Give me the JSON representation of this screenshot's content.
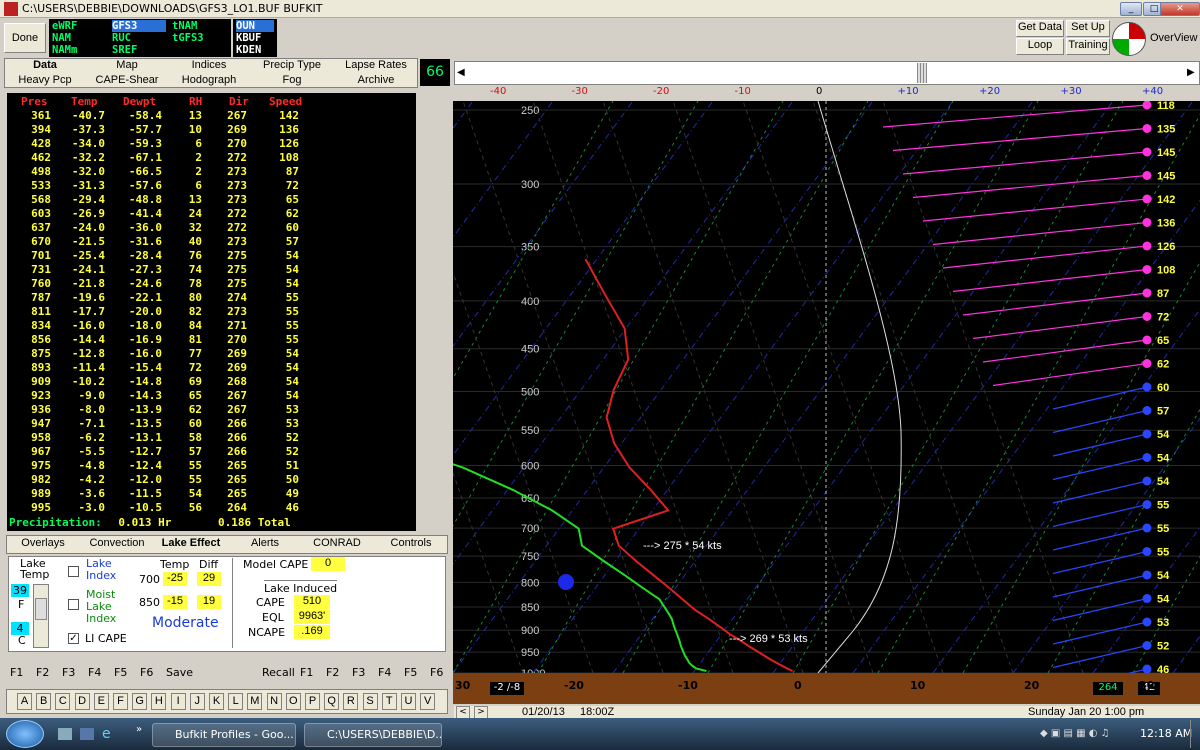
{
  "window": {
    "title": "C:\\USERS\\DEBBIE\\DOWNLOADS\\GFS3_LO1.BUF BUFKIT"
  },
  "toolbar": {
    "done": "Done",
    "models_col1": [
      "eWRF",
      "NAM",
      "NAMm"
    ],
    "models_col2": [
      "GFS3",
      "RUC",
      "SREF"
    ],
    "models_col3": [
      "tNAM",
      "tGFS3",
      ""
    ],
    "stations": [
      "OUN",
      "KBUF",
      "KDEN"
    ],
    "get_data": "Get Data",
    "set_up": "Set Up",
    "loop": "Loop",
    "training": "Training",
    "overview": "OverView",
    "counter": "66"
  },
  "tabs_row1": [
    "Data",
    "Map",
    "Indices",
    "Precip Type",
    "Lapse Rates"
  ],
  "tabs_row2": [
    "Heavy Pcp",
    "CAPE-Shear",
    "Hodograph",
    "Fog",
    "Archive"
  ],
  "table": {
    "headers": [
      "Pres",
      "Temp",
      "Dewpt",
      "RH",
      "Dir",
      "Speed"
    ],
    "rows": [
      [
        "361",
        "-40.7",
        "-58.4",
        "13",
        "267",
        "142"
      ],
      [
        "394",
        "-37.3",
        "-57.7",
        "10",
        "269",
        "136"
      ],
      [
        "428",
        "-34.0",
        "-59.3",
        "6",
        "270",
        "126"
      ],
      [
        "462",
        "-32.2",
        "-67.1",
        "2",
        "272",
        "108"
      ],
      [
        "498",
        "-32.0",
        "-66.5",
        "2",
        "273",
        "87"
      ],
      [
        "533",
        "-31.3",
        "-57.6",
        "6",
        "273",
        "72"
      ],
      [
        "568",
        "-29.4",
        "-48.8",
        "13",
        "273",
        "65"
      ],
      [
        "603",
        "-26.9",
        "-41.4",
        "24",
        "272",
        "62"
      ],
      [
        "637",
        "-24.0",
        "-36.0",
        "32",
        "272",
        "60"
      ],
      [
        "670",
        "-21.5",
        "-31.6",
        "40",
        "273",
        "57"
      ],
      [
        "701",
        "-25.4",
        "-28.4",
        "76",
        "275",
        "54"
      ],
      [
        "731",
        "-24.1",
        "-27.3",
        "74",
        "275",
        "54"
      ],
      [
        "760",
        "-21.8",
        "-24.6",
        "78",
        "275",
        "54"
      ],
      [
        "787",
        "-19.6",
        "-22.1",
        "80",
        "274",
        "55"
      ],
      [
        "811",
        "-17.7",
        "-20.0",
        "82",
        "273",
        "55"
      ],
      [
        "834",
        "-16.0",
        "-18.0",
        "84",
        "271",
        "55"
      ],
      [
        "856",
        "-14.4",
        "-16.9",
        "81",
        "270",
        "55"
      ],
      [
        "875",
        "-12.8",
        "-16.0",
        "77",
        "269",
        "54"
      ],
      [
        "893",
        "-11.4",
        "-15.4",
        "72",
        "269",
        "54"
      ],
      [
        "909",
        "-10.2",
        "-14.8",
        "69",
        "268",
        "54"
      ],
      [
        "923",
        "-9.0",
        "-14.3",
        "65",
        "267",
        "54"
      ],
      [
        "936",
        "-8.0",
        "-13.9",
        "62",
        "267",
        "53"
      ],
      [
        "947",
        "-7.1",
        "-13.5",
        "60",
        "266",
        "53"
      ],
      [
        "958",
        "-6.2",
        "-13.1",
        "58",
        "266",
        "52"
      ],
      [
        "967",
        "-5.5",
        "-12.7",
        "57",
        "266",
        "52"
      ],
      [
        "975",
        "-4.8",
        "-12.4",
        "55",
        "265",
        "51"
      ],
      [
        "982",
        "-4.2",
        "-12.0",
        "55",
        "265",
        "50"
      ],
      [
        "989",
        "-3.6",
        "-11.5",
        "54",
        "265",
        "49"
      ],
      [
        "995",
        "-3.0",
        "-10.5",
        "56",
        "264",
        "46"
      ]
    ],
    "precip_label": "Precipitation:",
    "precip_hr": "0.013 Hr",
    "precip_total": "0.186 Total"
  },
  "bottom_tabs": [
    "Overlays",
    "Convection",
    "Lake Effect",
    "Alerts",
    "CONRAD",
    "Controls"
  ],
  "lake": {
    "lake_temp_label": "Lake Temp",
    "temp_f": "39",
    "unit_f": "F",
    "temp_c": "4",
    "unit_c": "C",
    "lake_index": "Lake Index",
    "moist_lake_index": "Moist Lake Index",
    "li_cape": "LI CAPE",
    "col_temp": "Temp",
    "col_diff": "Diff",
    "lvl_700": "700",
    "t700": "-25",
    "d700": "29",
    "lvl_850": "850",
    "t850": "-15",
    "d850": "19",
    "intensity": "Moderate",
    "model_cape_label": "Model CAPE",
    "model_cape": "0",
    "lake_induced": "Lake Induced",
    "cape_label": "CAPE",
    "cape": "510",
    "eql_label": "EQL",
    "eql": "9963'",
    "ncape_label": "NCAPE",
    "ncape": ".169"
  },
  "fkeys_left": [
    "F1",
    "F2",
    "F3",
    "F4",
    "F5",
    "F6"
  ],
  "save": "Save",
  "recall": "Recall",
  "fkeys_right": [
    "F1",
    "F2",
    "F3",
    "F4",
    "F5",
    "F6"
  ],
  "alphabet": [
    "A",
    "B",
    "C",
    "D",
    "E",
    "F",
    "G",
    "H",
    "I",
    "J",
    "K",
    "L",
    "M",
    "N",
    "O",
    "P",
    "Q",
    "R",
    "S",
    "T",
    "U",
    "V"
  ],
  "skewt": {
    "top_temps": [
      "-40",
      "-30",
      "-20",
      "-10",
      "0",
      "+10",
      "+20",
      "+30",
      "+40"
    ],
    "pressures": [
      "250",
      "300",
      "350",
      "400",
      "450",
      "500",
      "550",
      "600",
      "650",
      "700",
      "750",
      "800",
      "850",
      "900",
      "950",
      "1000"
    ],
    "wind_speeds": [
      "118",
      "135",
      "145",
      "145",
      "142",
      "136",
      "126",
      "108",
      "87",
      "72",
      "65",
      "62",
      "60",
      "57",
      "54",
      "54",
      "54",
      "55",
      "55",
      "55",
      "54",
      "54",
      "53",
      "52",
      "46"
    ],
    "annot1": "---> 275 * 54 kts",
    "annot2": "---> 269 * 53 kts",
    "bottom_temps": [
      "30",
      "-20",
      "-10",
      "0",
      "10",
      "20",
      "30"
    ],
    "ground_left": "-2 /-8",
    "ground_right_a": "264",
    "ground_right_b": "42",
    "date": "01/20/13",
    "time": "18:00Z",
    "valid": "Sunday   Jan 20   1:00 pm"
  },
  "taskbar": {
    "app1": "Bufkit Profiles - Goo...",
    "app2": "C:\\USERS\\DEBBIE\\D...",
    "clock": "12:18 AM"
  }
}
